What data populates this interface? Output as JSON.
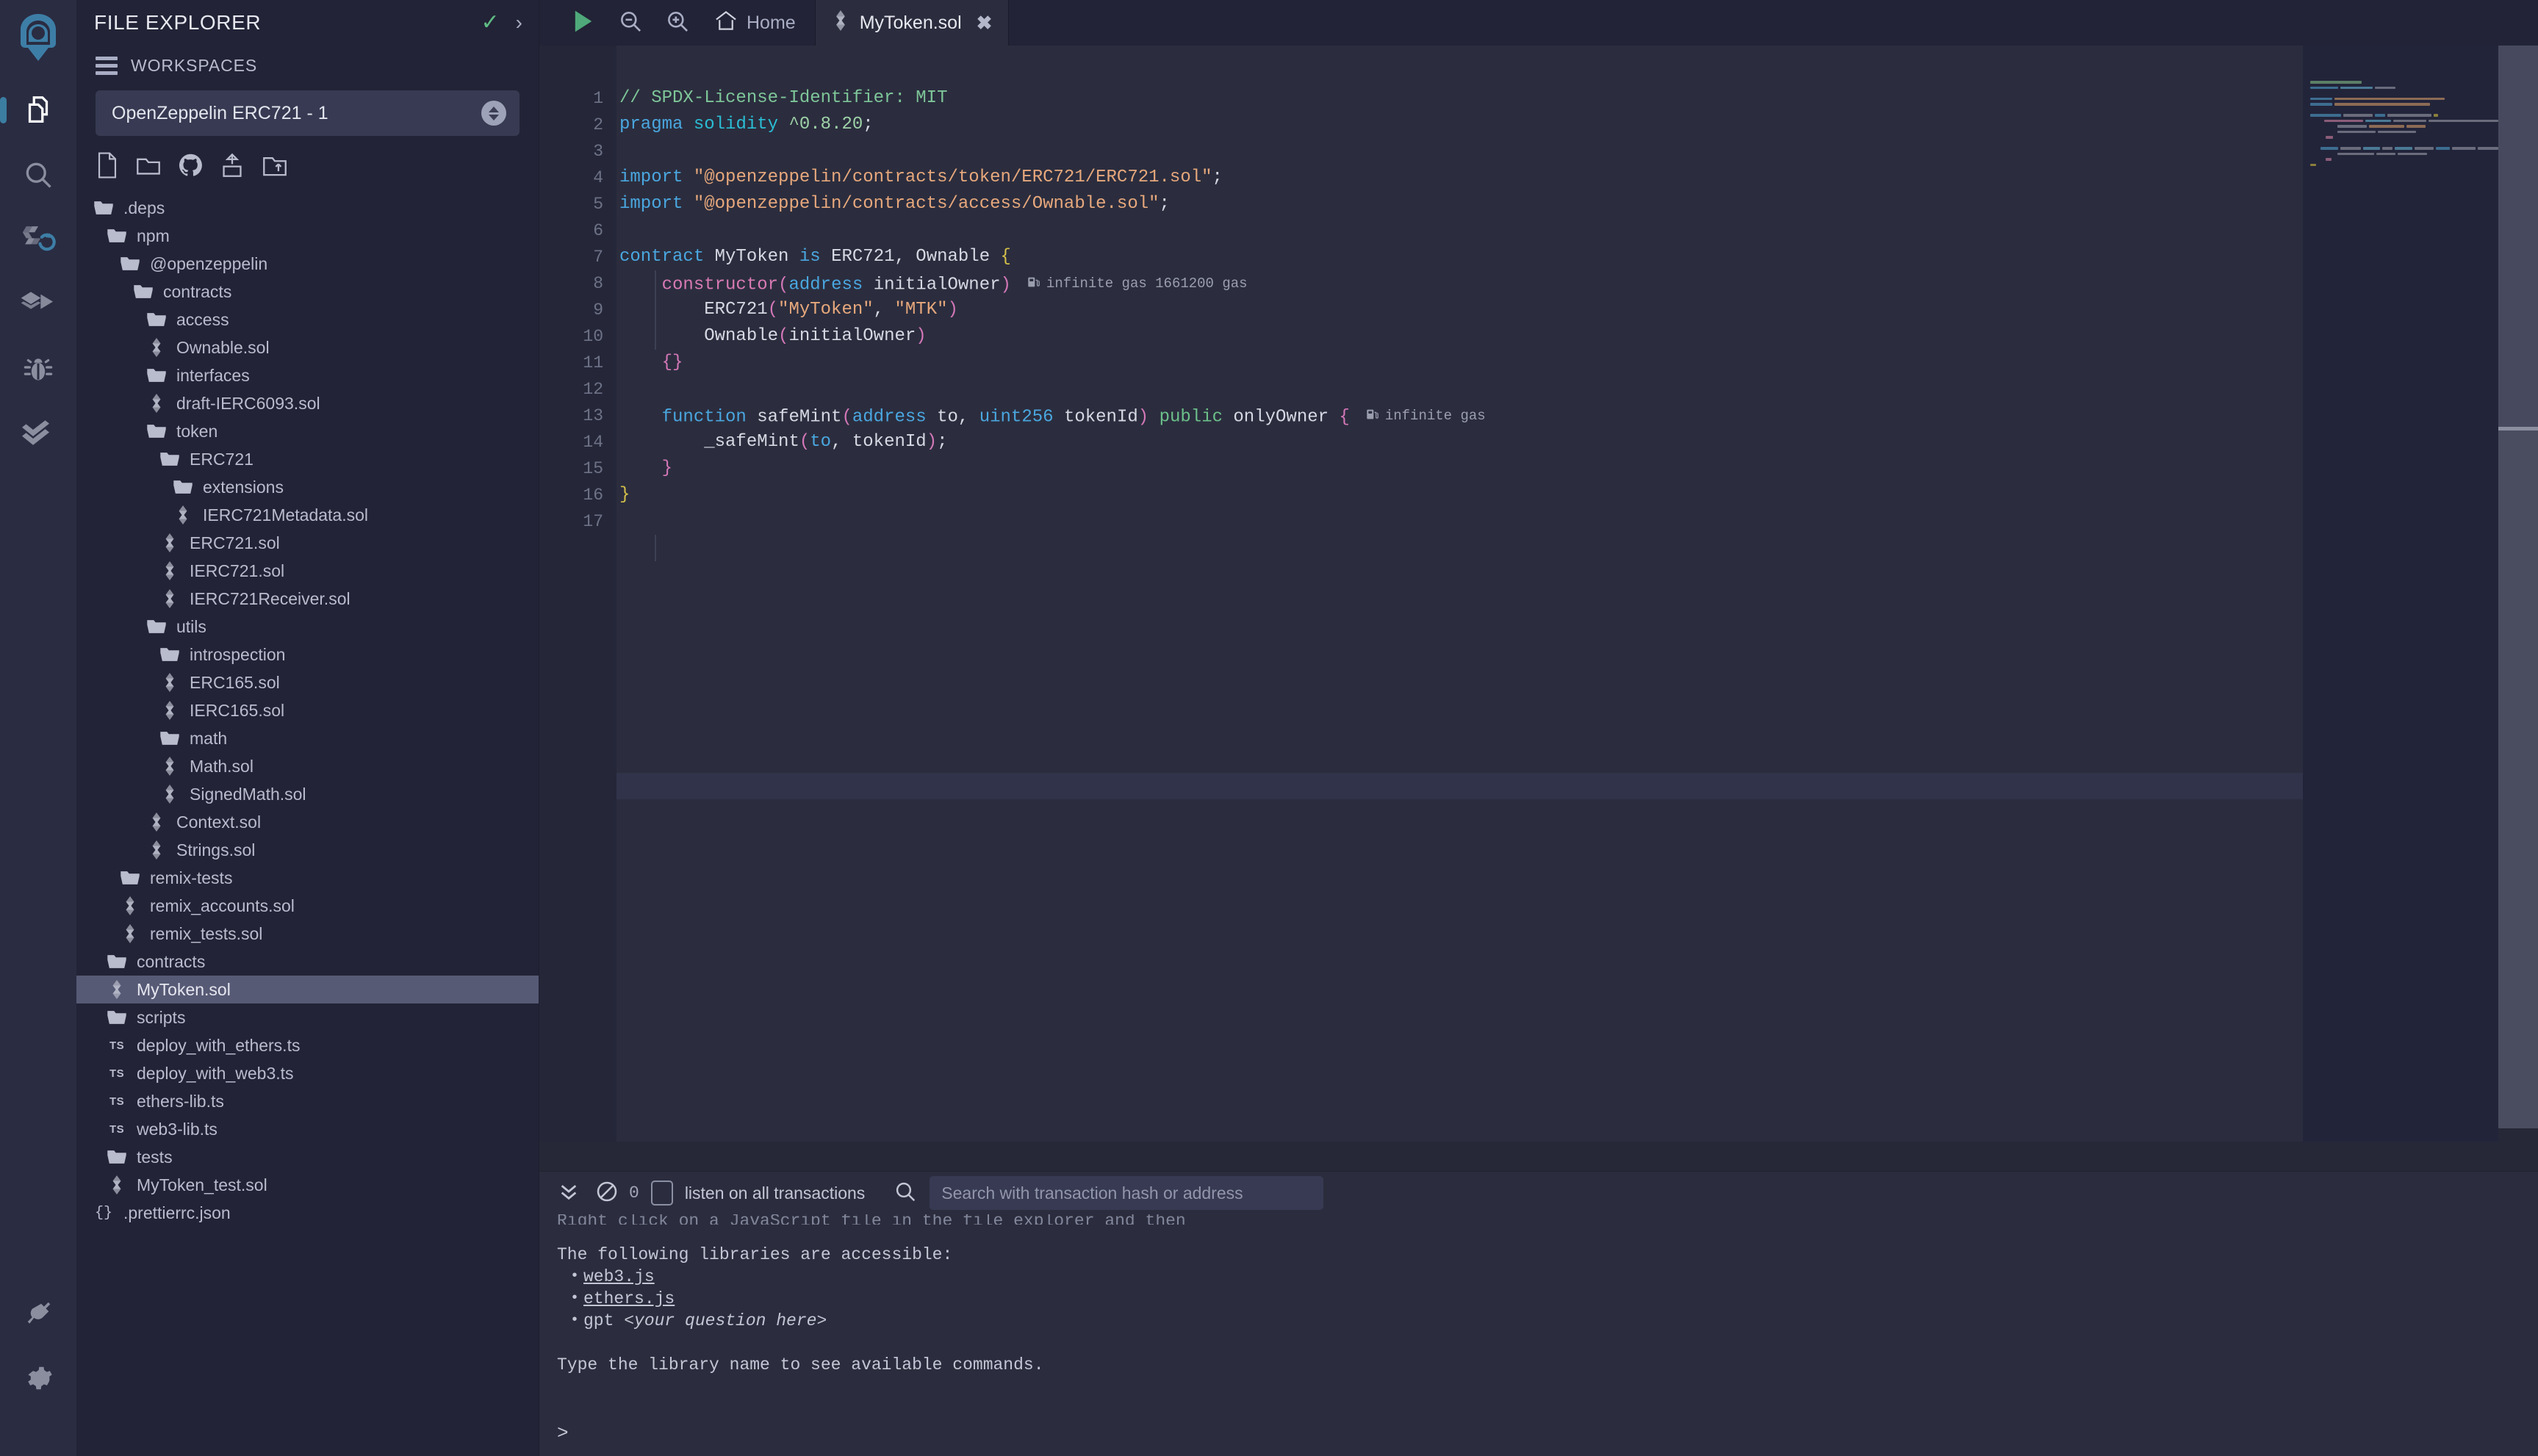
{
  "rail": {
    "logo_icon": "remix-logo-icon",
    "items": [
      {
        "name": "file-explorer",
        "icon": "files-icon",
        "active": true
      },
      {
        "name": "search",
        "icon": "search-icon",
        "active": false
      },
      {
        "name": "solidity-compiler",
        "icon": "solidity-compiler-icon",
        "active": false
      },
      {
        "name": "deploy-and-run",
        "icon": "deploy-run-icon",
        "active": false
      },
      {
        "name": "debugger",
        "icon": "bug-icon",
        "active": false
      },
      {
        "name": "solidity-unit-testing",
        "icon": "double-check-icon",
        "active": false
      }
    ],
    "bottom_items": [
      {
        "name": "plugin-manager",
        "icon": "plug-icon"
      },
      {
        "name": "settings",
        "icon": "gear-icon"
      }
    ]
  },
  "panel": {
    "title": "FILE EXPLORER",
    "header_icons": [
      {
        "name": "check-icon",
        "glyph": "✓",
        "color": "#5fbb83"
      },
      {
        "name": "chevron-right-icon",
        "glyph": "›",
        "color": "#a9adc4"
      }
    ],
    "workspaces_label": "WORKSPACES",
    "workspace_selected": "OpenZeppelin ERC721 - 1",
    "file_actions": [
      {
        "name": "create-new-file",
        "icon": "new-file-icon"
      },
      {
        "name": "create-new-folder",
        "icon": "new-folder-icon"
      },
      {
        "name": "clone-git-repository",
        "icon": "github-icon"
      },
      {
        "name": "publish-to-gist",
        "icon": "publish-gist-icon"
      },
      {
        "name": "upload-folder",
        "icon": "upload-folder-icon"
      }
    ],
    "tree": [
      {
        "label": ".deps",
        "depth": 0,
        "type": "folder"
      },
      {
        "label": "npm",
        "depth": 1,
        "type": "folder"
      },
      {
        "label": "@openzeppelin",
        "depth": 2,
        "type": "folder"
      },
      {
        "label": "contracts",
        "depth": 3,
        "type": "folder"
      },
      {
        "label": "access",
        "depth": 4,
        "type": "folder"
      },
      {
        "label": "Ownable.sol",
        "depth": 4,
        "type": "sol"
      },
      {
        "label": "interfaces",
        "depth": 4,
        "type": "folder"
      },
      {
        "label": "draft-IERC6093.sol",
        "depth": 4,
        "type": "sol"
      },
      {
        "label": "token",
        "depth": 4,
        "type": "folder"
      },
      {
        "label": "ERC721",
        "depth": 5,
        "type": "folder"
      },
      {
        "label": "extensions",
        "depth": 6,
        "type": "folder"
      },
      {
        "label": "IERC721Metadata.sol",
        "depth": 6,
        "type": "sol"
      },
      {
        "label": "ERC721.sol",
        "depth": 5,
        "type": "sol"
      },
      {
        "label": "IERC721.sol",
        "depth": 5,
        "type": "sol"
      },
      {
        "label": "IERC721Receiver.sol",
        "depth": 5,
        "type": "sol"
      },
      {
        "label": "utils",
        "depth": 4,
        "type": "folder"
      },
      {
        "label": "introspection",
        "depth": 5,
        "type": "folder"
      },
      {
        "label": "ERC165.sol",
        "depth": 5,
        "type": "sol"
      },
      {
        "label": "IERC165.sol",
        "depth": 5,
        "type": "sol"
      },
      {
        "label": "math",
        "depth": 5,
        "type": "folder"
      },
      {
        "label": "Math.sol",
        "depth": 5,
        "type": "sol"
      },
      {
        "label": "SignedMath.sol",
        "depth": 5,
        "type": "sol"
      },
      {
        "label": "Context.sol",
        "depth": 4,
        "type": "sol"
      },
      {
        "label": "Strings.sol",
        "depth": 4,
        "type": "sol"
      },
      {
        "label": "remix-tests",
        "depth": 2,
        "type": "folder"
      },
      {
        "label": "remix_accounts.sol",
        "depth": 2,
        "type": "sol"
      },
      {
        "label": "remix_tests.sol",
        "depth": 2,
        "type": "sol"
      },
      {
        "label": "contracts",
        "depth": 1,
        "type": "folder"
      },
      {
        "label": "MyToken.sol",
        "depth": 1,
        "type": "sol",
        "selected": true
      },
      {
        "label": "scripts",
        "depth": 1,
        "type": "folder"
      },
      {
        "label": "deploy_with_ethers.ts",
        "depth": 1,
        "type": "ts"
      },
      {
        "label": "deploy_with_web3.ts",
        "depth": 1,
        "type": "ts"
      },
      {
        "label": "ethers-lib.ts",
        "depth": 1,
        "type": "ts"
      },
      {
        "label": "web3-lib.ts",
        "depth": 1,
        "type": "ts"
      },
      {
        "label": "tests",
        "depth": 1,
        "type": "folder"
      },
      {
        "label": "MyToken_test.sol",
        "depth": 1,
        "type": "sol"
      },
      {
        "label": ".prettierrc.json",
        "depth": 0,
        "type": "json"
      }
    ]
  },
  "tabbar": {
    "tools": [
      {
        "name": "run-script-button",
        "icon": "play-icon"
      },
      {
        "name": "zoom-out-button",
        "icon": "zoom-out-icon"
      },
      {
        "name": "zoom-in-button",
        "icon": "zoom-in-icon"
      }
    ],
    "home_tab": "Home",
    "tabs": [
      {
        "label": "MyToken.sol",
        "icon": "solidity-icon",
        "close": "✖",
        "active": true
      }
    ]
  },
  "editor": {
    "line_numbers": [
      "1",
      "2",
      "3",
      "4",
      "5",
      "6",
      "7",
      "8",
      "9",
      "10",
      "11",
      "12",
      "13",
      "14",
      "15",
      "16",
      "17"
    ],
    "gas_annotations": [
      {
        "line": 8,
        "text": "infinite gas 1661200 gas"
      },
      {
        "line": 13,
        "text": "infinite gas"
      }
    ],
    "source_lines": [
      "// SPDX-License-Identifier: MIT",
      "pragma solidity ^0.8.20;",
      "",
      "import \"@openzeppelin/contracts/token/ERC721/ERC721.sol\";",
      "import \"@openzeppelin/contracts/access/Ownable.sol\";",
      "",
      "contract MyToken is ERC721, Ownable {",
      "    constructor(address initialOwner)",
      "        ERC721(\"MyToken\", \"MTK\")",
      "        Ownable(initialOwner)",
      "    {}",
      "",
      "    function safeMint(address to, uint256 tokenId) public onlyOwner {",
      "        _safeMint(to, tokenId);",
      "    }",
      "}",
      ""
    ]
  },
  "terminal": {
    "toolbar": {
      "collapse_icon": "chevrons-down-icon",
      "clear_icon": "ban-icon",
      "pending_count": "0",
      "listen_label": "listen on all transactions",
      "search_icon": "search-icon",
      "search_placeholder": "Search with transaction hash or address",
      "search_value": ""
    },
    "lines": {
      "clipped": "Right click on a JavaScript file in the file explorer and then",
      "intro": "The following libraries are accessible:",
      "items": [
        {
          "text": "web3.js",
          "link": true
        },
        {
          "text": "ethers.js",
          "link": true
        },
        {
          "text": "gpt ",
          "suffix": "<your question here>",
          "link": false
        }
      ],
      "hint": "Type the library name to see available commands.",
      "prompt": ">"
    }
  },
  "colors": {
    "rail_bg": "#2a2c42",
    "panel_bg": "#222336",
    "editor_bg": "#2b2d3e",
    "gutter_bg": "#252739",
    "minimap_bg": "#22243a",
    "accent_active": "#3b7ea1",
    "selection": "#575a75",
    "check_green": "#5fbb83",
    "play_green": "#4fa97a"
  }
}
